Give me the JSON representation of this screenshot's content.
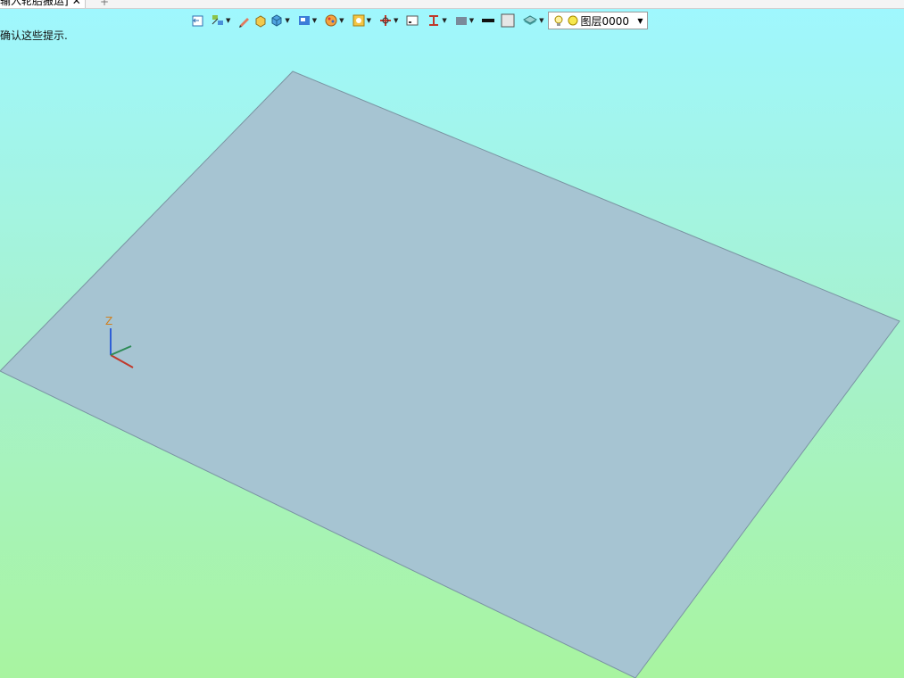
{
  "tab": {
    "title": "输入轮胎搬运]",
    "close_glyph": "✕",
    "add_glyph": "+"
  },
  "hint_text": "确认这些提示.",
  "toolbar": {
    "icons": [
      "exit-icon",
      "show-hide-icon",
      "pencil-icon",
      "solid-box-icon",
      "cube-icon",
      "views-icon",
      "render-palette-icon",
      "display-icon",
      "move-icon",
      "window-icon",
      "section-icon",
      "plane-icon",
      "line-weight-icon",
      "color-icon",
      "layer-icon"
    ],
    "layer": {
      "name": "图层0000",
      "icons": [
        "lightbulb-icon",
        "color-dot-icon"
      ]
    }
  },
  "viewport": {
    "triad": {
      "z_label": "Z"
    },
    "colors": {
      "floor": "#a6c4d2"
    }
  }
}
